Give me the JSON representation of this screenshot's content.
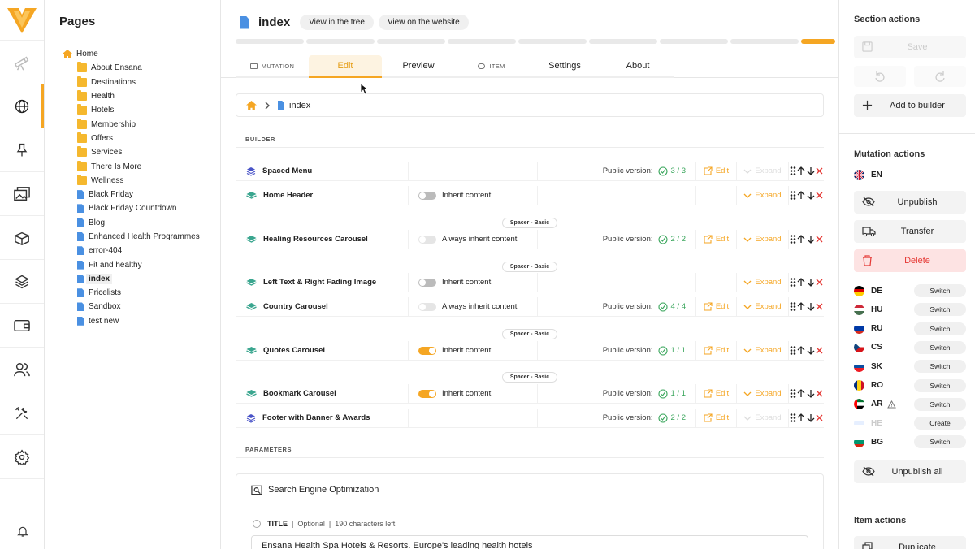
{
  "tree": {
    "title": "Pages",
    "home": "Home",
    "items": [
      {
        "label": "About Ensana",
        "type": "folder"
      },
      {
        "label": "Destinations",
        "type": "folder"
      },
      {
        "label": "Health",
        "type": "folder"
      },
      {
        "label": "Hotels",
        "type": "folder"
      },
      {
        "label": "Membership",
        "type": "folder"
      },
      {
        "label": "Offers",
        "type": "folder"
      },
      {
        "label": "Services",
        "type": "folder"
      },
      {
        "label": "There Is More",
        "type": "folder"
      },
      {
        "label": "Wellness",
        "type": "folder"
      },
      {
        "label": "Black Friday",
        "type": "file"
      },
      {
        "label": "Black Friday Countdown",
        "type": "file"
      },
      {
        "label": "Blog",
        "type": "file"
      },
      {
        "label": "Enhanced Health Programmes",
        "type": "file"
      },
      {
        "label": "error-404",
        "type": "file"
      },
      {
        "label": "Fit and healthy",
        "type": "file"
      },
      {
        "label": "index",
        "type": "file",
        "selected": true
      },
      {
        "label": "Pricelists",
        "type": "file"
      },
      {
        "label": "Sandbox",
        "type": "file"
      },
      {
        "label": "test new",
        "type": "file"
      }
    ]
  },
  "header": {
    "title": "index",
    "view_tree": "View in the tree",
    "view_site": "View on the website"
  },
  "tabs": [
    {
      "label": "MUTATION",
      "small": true
    },
    {
      "label": "Edit",
      "active": true
    },
    {
      "label": "Preview"
    },
    {
      "label": "ITEM",
      "small": true
    },
    {
      "label": "Settings"
    },
    {
      "label": "About"
    }
  ],
  "breadcrumb": {
    "page": "index"
  },
  "builder": {
    "heading": "BUILDER",
    "public_label": "Public version:",
    "edit_label": "Edit",
    "expand_label": "Expand",
    "rows": [
      {
        "name": "Spaced Menu",
        "icon": "layers",
        "toggle": null,
        "public": "3 / 3",
        "edit": true,
        "expand_disabled": true
      },
      {
        "name": "Home Header",
        "icon": "stack",
        "toggle": "off",
        "toggle_label": "Inherit content",
        "public": null,
        "edit": false,
        "expand_disabled": false
      },
      {
        "spacer": "Spacer - Basic"
      },
      {
        "name": "Healing Resources Carousel",
        "icon": "stack",
        "toggle": "light",
        "toggle_label": "Always inherit content",
        "public": "2 / 2",
        "edit": true,
        "expand_disabled": false
      },
      {
        "spacer": "Spacer - Basic"
      },
      {
        "name": "Left Text & Right Fading Image",
        "icon": "stack",
        "toggle": "off",
        "toggle_label": "Inherit content",
        "public": null,
        "edit": false,
        "expand_disabled": false
      },
      {
        "name": "Country Carousel",
        "icon": "stack",
        "toggle": "light",
        "toggle_label": "Always inherit content",
        "public": "4 / 4",
        "edit": true,
        "expand_disabled": false
      },
      {
        "spacer": "Spacer - Basic"
      },
      {
        "name": "Quotes Carousel",
        "icon": "stack",
        "toggle": "on",
        "toggle_label": "Inherit content",
        "public": "1 / 1",
        "edit": true,
        "expand_disabled": false
      },
      {
        "spacer": "Spacer - Basic"
      },
      {
        "name": "Bookmark Carousel",
        "icon": "stack",
        "toggle": "on",
        "toggle_label": "Inherit content",
        "public": "1 / 1",
        "edit": true,
        "expand_disabled": false
      },
      {
        "name": "Footer with Banner & Awards",
        "icon": "layers",
        "toggle": null,
        "public": "2 / 2",
        "edit": true,
        "expand_disabled": true
      }
    ]
  },
  "parameters": {
    "heading": "PARAMETERS",
    "seo_title": "Search Engine Optimization",
    "field_label": "TITLE",
    "field_optional": "Optional",
    "field_left": "190 characters left",
    "field_value": "Ensana Health Spa Hotels & Resorts. Europe's leading health hotels"
  },
  "right": {
    "section_title": "Section actions",
    "save": "Save",
    "add_builder": "Add to builder",
    "mutation_title": "Mutation actions",
    "current_lang": "EN",
    "unpublish": "Unpublish",
    "transfer": "Transfer",
    "delete": "Delete",
    "langs": [
      {
        "code": "DE",
        "action": "Switch",
        "flag": [
          "#000",
          "#d00",
          "#fc0"
        ]
      },
      {
        "code": "HU",
        "action": "Switch",
        "flag": [
          "#ce2939",
          "#fff",
          "#477050"
        ]
      },
      {
        "code": "RU",
        "action": "Switch",
        "flag": [
          "#fff",
          "#0039a6",
          "#d52b1e"
        ]
      },
      {
        "code": "CS",
        "action": "Switch",
        "flag": [
          "#fff",
          "#d7141a"
        ],
        "czech": true
      },
      {
        "code": "SK",
        "action": "Switch",
        "flag": [
          "#fff",
          "#0b4ea2",
          "#ee1c25"
        ]
      },
      {
        "code": "RO",
        "action": "Switch",
        "flag": [
          "#002b7f",
          "#fcd116",
          "#ce1126"
        ],
        "vertical": true
      },
      {
        "code": "AR",
        "action": "Switch",
        "flag": [
          "#00732f",
          "#fff",
          "#000"
        ],
        "uae": true,
        "warn": true
      },
      {
        "code": "HE",
        "action": "Create",
        "flag": [
          "#fff",
          "#cfe0ff",
          "#fff"
        ],
        "faded": true
      },
      {
        "code": "BG",
        "action": "Switch",
        "flag": [
          "#fff",
          "#00966e",
          "#d62612"
        ]
      }
    ],
    "unpublish_all": "Unpublish all",
    "item_title": "Item actions",
    "duplicate": "Duplicate"
  }
}
